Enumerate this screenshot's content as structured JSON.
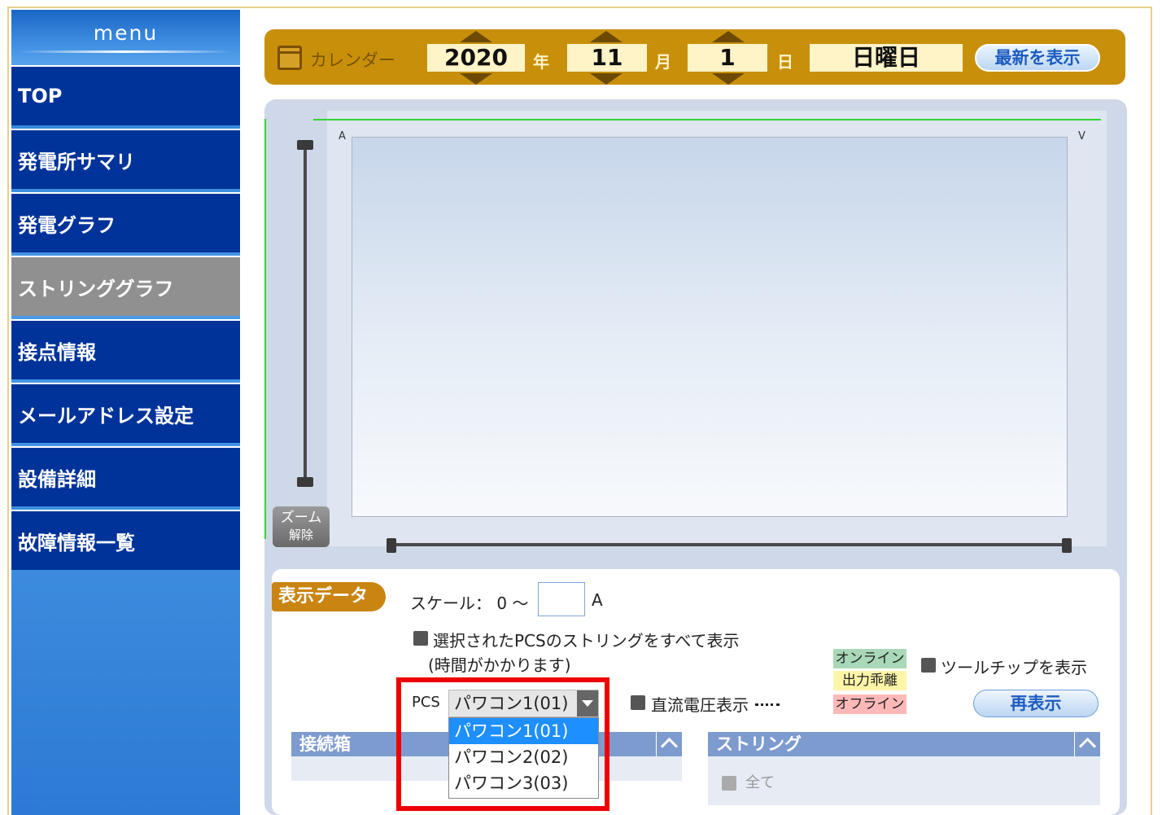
{
  "sidebar": {
    "title": "menu",
    "items": [
      {
        "label": "TOP"
      },
      {
        "label": "発電所サマリ"
      },
      {
        "label": "発電グラフ"
      },
      {
        "label": "ストリンググラフ"
      },
      {
        "label": "接点情報"
      },
      {
        "label": "メールアドレス設定"
      },
      {
        "label": "設備詳細"
      },
      {
        "label": "故障情報一覧"
      }
    ],
    "active": "ストリンググラフ"
  },
  "calendar": {
    "label": "カレンダー",
    "year": "2020",
    "year_unit": "年",
    "month": "11",
    "month_unit": "月",
    "day": "1",
    "day_unit": "日",
    "weekday": "日曜日",
    "latest_button": "最新を表示"
  },
  "graph": {
    "left_axis_unit": "A",
    "right_axis_unit": "V",
    "zoom_reset": "ズーム",
    "zoom_reset_sub": "解除"
  },
  "display_data": {
    "tag": "表示データ",
    "scale_label": "スケール： 0 ～",
    "scale_value": "",
    "scale_unit": "A",
    "show_all_label": "選択されたPCSのストリングをすべて表示",
    "show_all_note": "(時間がかかります)",
    "status": {
      "online": "オンライン",
      "away": "出力乖離",
      "offline": "オフライン"
    },
    "tooltip_label": "ツールチップを表示",
    "dc_voltage_label": "直流電圧表示",
    "redisplay_button": "再表示",
    "pcs_label": "PCS",
    "pcs_selected": "パワコン1(01)",
    "pcs_options": [
      "パワコン1(01)",
      "パワコン2(02)",
      "パワコン3(03)"
    ],
    "junction_box_header": "接続箱",
    "string_header": "ストリング",
    "string_all_label": "全て"
  },
  "colors": {
    "nav_blue": "#003399",
    "nav_active": "#909090",
    "calendar_gold": "#c8900a",
    "highlight_red": "#ee0000",
    "dropdown_selected": "#1e8fff"
  }
}
